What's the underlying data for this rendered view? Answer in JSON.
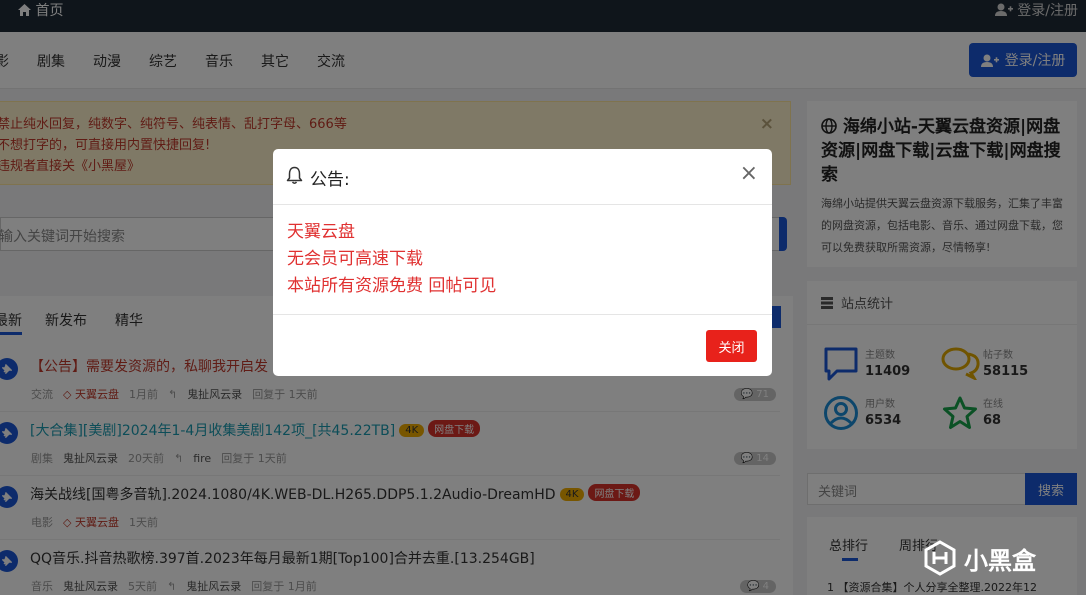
{
  "topbar": {
    "home_label": "首页",
    "login_label": "登录/注册"
  },
  "nav": {
    "items": [
      "影",
      "剧集",
      "动漫",
      "综艺",
      "音乐",
      "其它",
      "交流"
    ],
    "login_button": "登录/注册"
  },
  "notice": {
    "lines": [
      "禁止纯水回复，纯数字、纯符号、纯表情、乱打字母、666等",
      "不想打字的，可直接用内置快捷回复!",
      "违规者直接关《小黑屋》"
    ]
  },
  "search": {
    "placeholder": "输入关键词开始搜索"
  },
  "tabs": [
    "最新",
    "新发布",
    "精华"
  ],
  "threads": [
    {
      "title": "【公告】需要发资源的，私聊我开启发",
      "category": "交流",
      "author": "天翼云盘",
      "time": "1月前",
      "replier": "鬼扯风云录",
      "reply_time": "回复于 1天前",
      "comments": "71"
    },
    {
      "title": "[大合集][美剧]2024年1-4月收集美剧142项_[共45.22TB]",
      "badge1": "4K",
      "badge2": "网盘下载",
      "category": "剧集",
      "author": "鬼扯风云录",
      "time": "20天前",
      "replier": "fire",
      "reply_time": "回复于 1天前",
      "comments": "14"
    },
    {
      "title": "海关战线[国粤多音轨].2024.1080/4K.WEB-DL.H265.DDP5.1.2Audio-DreamHD",
      "badge1": "4K",
      "badge2": "网盘下载",
      "category": "电影",
      "author": "天翼云盘",
      "time": "1天前"
    },
    {
      "title": "QQ音乐.抖音热歌榜.397首.2023年每月最新1期[Top100]合并去重.[13.254GB]",
      "category": "音乐",
      "author": "鬼扯风云录",
      "time": "5天前",
      "replier": "鬼扯风云录",
      "reply_time": "回复于 1月前",
      "comments": "4"
    }
  ],
  "sidebar": {
    "site_title": "海绵小站-天翼云盘资源|网盘资源|网盘下载|云盘下载|网盘搜索",
    "site_desc": "海绵小站提供天翼云盘资源下载服务，汇集了丰富的网盘资源，包括电影、音乐、通过网盘下载，您可以免费获取所需资源，尽情畅享!",
    "stats_title": "站点统计",
    "stats": [
      {
        "label": "主题数",
        "value": "11409"
      },
      {
        "label": "帖子数",
        "value": "58115"
      },
      {
        "label": "用户数",
        "value": "6534"
      },
      {
        "label": "在线",
        "value": "68"
      }
    ],
    "search_placeholder": "关键词",
    "search_button": "搜索",
    "rank_tabs": [
      "总排行",
      "周排行"
    ],
    "rank_first": "1 【资源合集】个人分享全整理.2022年12"
  },
  "watermark": "小黑盒",
  "modal": {
    "title": "公告:",
    "lines": [
      "天翼云盘",
      "无会员可高速下载",
      "本站所有资源免费 回帖可见"
    ],
    "close_button": "关闭"
  }
}
